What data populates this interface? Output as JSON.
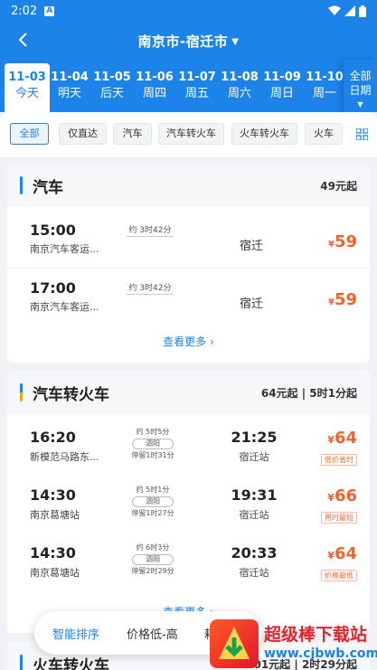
{
  "status_bar": {
    "time": "2:02",
    "notif": "A"
  },
  "header": {
    "route": "南京市-宿迁市",
    "colors": {
      "primary": "#1c83e8",
      "price": "#f0632f"
    }
  },
  "dates": [
    {
      "date": "11-03",
      "day": "今天"
    },
    {
      "date": "11-04",
      "day": "明天"
    },
    {
      "date": "11-05",
      "day": "后天"
    },
    {
      "date": "11-06",
      "day": "周四"
    },
    {
      "date": "11-07",
      "day": "周五"
    },
    {
      "date": "11-08",
      "day": "周六"
    },
    {
      "date": "11-09",
      "day": "周日"
    },
    {
      "date": "11-10",
      "day": "周一"
    }
  ],
  "all_dates": {
    "line1": "全部",
    "line2": "日期"
  },
  "filters": [
    "全部",
    "仅直达",
    "汽车",
    "汽车转火车",
    "火车转火车",
    "火车"
  ],
  "bus": {
    "title": "汽车",
    "price": "49元起",
    "rows": [
      {
        "dep": "15:00",
        "from": "南京汽车客运...",
        "duration": "约 3时42分",
        "to": "宿迁",
        "price": "59",
        "currency": "¥"
      },
      {
        "dep": "17:00",
        "from": "南京汽车客运...",
        "duration": "约 3时42分",
        "to": "宿迁",
        "price": "59",
        "currency": "¥"
      }
    ],
    "more": "查看更多"
  },
  "bus_train": {
    "title": "汽车转火车",
    "price": "64元起",
    "duration": "5时1分起",
    "rows": [
      {
        "dep": "16:20",
        "from": "新模范马路东...",
        "total": "约 5时5分",
        "via": "泗阳",
        "stay": "停留1时31分",
        "arr": "21:25",
        "to": "宿迁站",
        "currency": "¥",
        "price": "64",
        "tag": "低价省时"
      },
      {
        "dep": "14:30",
        "from": "南京葛塘站",
        "total": "约 5时1分",
        "via": "泗阳",
        "stay": "停留1时27分",
        "arr": "19:31",
        "to": "宿迁站",
        "currency": "¥",
        "price": "66",
        "tag": "用时最短"
      },
      {
        "dep": "14:30",
        "from": "南京葛塘站",
        "total": "约 6时3分",
        "via": "泗阳",
        "stay": "停留2时29分",
        "arr": "20:33",
        "to": "宿迁站",
        "currency": "¥",
        "price": "64",
        "tag": "价格最低"
      }
    ],
    "more": "查看更多"
  },
  "train_train": {
    "title": "火车转火车",
    "price": "101元起",
    "duration": "2时29分起"
  },
  "sort": {
    "smart": "智能排序",
    "price": "价格低-高",
    "third": "耗"
  },
  "watermark": {
    "title": "超级棒下载站",
    "url": "www.cjbwb.com"
  }
}
